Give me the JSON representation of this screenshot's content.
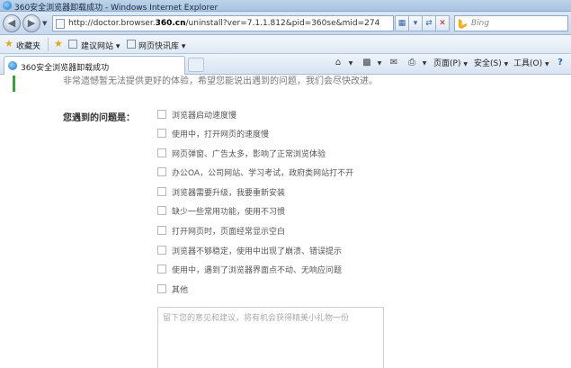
{
  "window": {
    "title": "360安全浏览器卸载成功 - Windows Internet Explorer"
  },
  "address_bar": {
    "url_prefix": "http://doctor.browser.",
    "url_domain": "360.cn",
    "url_suffix": "/uninstall?ver=7.1.1.812&pid=360se&mid=274",
    "search_placeholder": "Bing",
    "icons": [
      "back-icon",
      "forward-icon",
      "page-icon",
      "compat-icon",
      "refresh-icon",
      "stop-icon",
      "bing-icon"
    ]
  },
  "favorites_bar": {
    "favorites_label": "收藏夹",
    "items": [
      {
        "label": "建议网站 ▾"
      },
      {
        "label": "网页快讯库 ▾"
      }
    ]
  },
  "tabs": [
    {
      "label": "360安全浏览器卸载成功"
    }
  ],
  "command_bar": {
    "page_label": "页面(P)",
    "safety_label": "安全(S)",
    "tools_label": "工具(O)",
    "help_icon": "help-icon"
  },
  "content": {
    "intro_text": "非常遗憾暂无法提供更好的体验，希望您能说出遇到的问题，我们会尽快改进。",
    "question_label": "您遇到的问题是：",
    "options": [
      {
        "label": "浏览器启动速度慢",
        "checked": false
      },
      {
        "label": "使用中，打开网页的速度慢",
        "checked": false
      },
      {
        "label": "网页弹窗、广告太多，影响了正常浏览体验",
        "checked": false
      },
      {
        "label": "办公OA，公司网站、学习考试，政府类网站打不开",
        "checked": false
      },
      {
        "label": "浏览器需要升级，我要重新安装",
        "checked": false
      },
      {
        "label": "缺少一些常用功能，使用不习惯",
        "checked": false
      },
      {
        "label": "打开网页时，页面经常显示空白",
        "checked": false
      },
      {
        "label": "浏览器不够稳定，使用中出现了崩溃、错误提示",
        "checked": false
      },
      {
        "label": "使用中，遇到了浏览器界面点不动、无响应问题",
        "checked": false
      },
      {
        "label": "其他",
        "checked": false
      }
    ],
    "feedback_placeholder": "留下您的意见和建议，将有机会获得精美小礼物一份"
  }
}
